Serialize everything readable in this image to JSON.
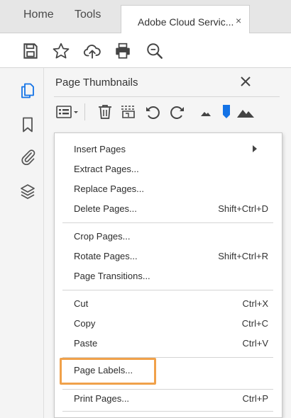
{
  "tabs": {
    "home": "Home",
    "tools": "Tools",
    "document": "Adobe Cloud Servic...",
    "close_glyph": "×"
  },
  "toolbar": {
    "icons": [
      "save-icon",
      "star-icon",
      "cloud-upload-icon",
      "print-icon",
      "search-zoom-icon"
    ]
  },
  "left_nav": {
    "icons": [
      "page-thumbnails-icon",
      "bookmark-icon",
      "attachment-icon",
      "layers-icon"
    ],
    "active_color": "#1473e6"
  },
  "panel": {
    "title": "Page Thumbnails",
    "tools": [
      "options-menu-icon",
      "delete-icon",
      "crop-icon",
      "rotate-left-icon",
      "rotate-right-icon",
      "zoom-out-icon",
      "zoom-slider-icon",
      "zoom-in-icon"
    ]
  },
  "menu": {
    "items": [
      {
        "label": "Insert Pages",
        "shortcut": "",
        "submenu": true
      },
      {
        "label": "Extract Pages...",
        "shortcut": ""
      },
      {
        "label": "Replace Pages...",
        "shortcut": ""
      },
      {
        "label": "Delete Pages...",
        "shortcut": "Shift+Ctrl+D"
      },
      {
        "label": "Crop Pages...",
        "shortcut": ""
      },
      {
        "label": "Rotate Pages...",
        "shortcut": "Shift+Ctrl+R"
      },
      {
        "label": "Page Transitions...",
        "shortcut": ""
      },
      {
        "label": "Cut",
        "shortcut": "Ctrl+X"
      },
      {
        "label": "Copy",
        "shortcut": "Ctrl+C"
      },
      {
        "label": "Paste",
        "shortcut": "Ctrl+V"
      },
      {
        "label": "Page Labels...",
        "shortcut": ""
      },
      {
        "label": "Print Pages...",
        "shortcut": "Ctrl+P"
      }
    ]
  },
  "highlight_color": "#f0a14a"
}
